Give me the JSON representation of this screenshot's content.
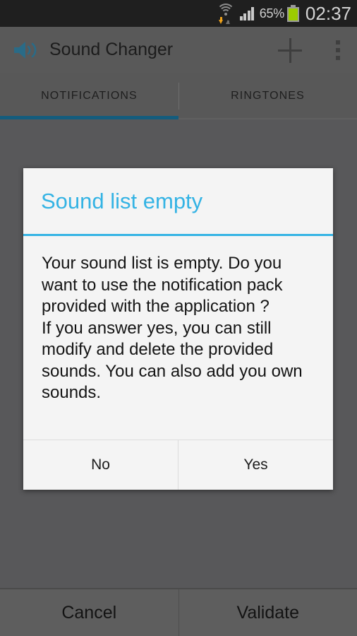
{
  "status_bar": {
    "wifi_icon": "wifi-icon",
    "wifi_download_arrow": "download-arrow-icon",
    "wifi_upload_arrow": "upload-arrow-icon",
    "signal_icon": "cellular-signal-icon",
    "battery_percent": "65%",
    "battery_icon": "battery-icon",
    "battery_color": "#9ccc00",
    "clock": "02:37"
  },
  "action_bar": {
    "app_icon": "speaker-sound-icon",
    "app_icon_color": "#2a6b87",
    "title": "Sound Changer",
    "add_label": "+",
    "add_icon": "plus-icon",
    "overflow_icon": "overflow-menu-icon"
  },
  "tabs": {
    "accent_color": "#145c7d",
    "items": [
      {
        "label": "NOTIFICATIONS",
        "selected": true
      },
      {
        "label": "RINGTONES",
        "selected": false
      }
    ]
  },
  "dialog": {
    "title": "Sound list empty",
    "title_color": "#34b3e4",
    "message": "Your sound list is empty. Do you want to use the notification pack provided with the application ?\n If you answer yes, you can still modify and delete the provided sounds. You can also add you own sounds.",
    "buttons": [
      {
        "label": "No"
      },
      {
        "label": "Yes"
      }
    ]
  },
  "bottom_bar": {
    "buttons": [
      {
        "label": "Cancel"
      },
      {
        "label": "Validate"
      }
    ]
  }
}
